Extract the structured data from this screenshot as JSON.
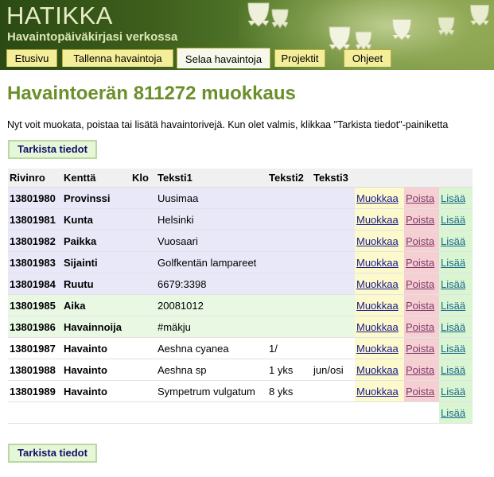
{
  "header": {
    "brand_title": "HATIKKA",
    "brand_subtitle": "Havaintopäiväkirjasi verkossa",
    "tabs": [
      {
        "label": "Etusivu",
        "active": false
      },
      {
        "label": "Tallenna havaintoja",
        "active": false
      },
      {
        "label": "Selaa havaintoja",
        "active": true
      },
      {
        "label": "Projektit",
        "active": false
      },
      {
        "label": "Ohjeet",
        "active": false
      }
    ]
  },
  "main": {
    "title": "Havaintoerän 811272 muokkaus",
    "intro": "Nyt voit muokata, poistaa tai lisätä havaintorivejä. Kun olet valmis, klikkaa \"Tarkista tiedot\"-painiketta",
    "check_button": "Tarkista tiedot",
    "table": {
      "headers": [
        "Rivinro",
        "Kenttä",
        "Klo",
        "Teksti1",
        "Teksti2",
        "Teksti3"
      ],
      "actions": {
        "edit": "Muokkaa",
        "delete": "Poista",
        "add": "Lisää"
      },
      "rows": [
        {
          "rivinro": "13801980",
          "kentta": "Provinssi",
          "klo": "",
          "teksti1": "Uusimaa",
          "teksti2": "",
          "teksti3": "",
          "shade": "blue"
        },
        {
          "rivinro": "13801981",
          "kentta": "Kunta",
          "klo": "",
          "teksti1": "Helsinki",
          "teksti2": "",
          "teksti3": "",
          "shade": "blue"
        },
        {
          "rivinro": "13801982",
          "kentta": "Paikka",
          "klo": "",
          "teksti1": "Vuosaari",
          "teksti2": "",
          "teksti3": "",
          "shade": "blue"
        },
        {
          "rivinro": "13801983",
          "kentta": "Sijainti",
          "klo": "",
          "teksti1": "Golfkentän lampareet",
          "teksti2": "",
          "teksti3": "",
          "shade": "blue"
        },
        {
          "rivinro": "13801984",
          "kentta": "Ruutu",
          "klo": "",
          "teksti1": "6679:3398",
          "teksti2": "",
          "teksti3": "",
          "shade": "blue"
        },
        {
          "rivinro": "13801985",
          "kentta": "Aika",
          "klo": "",
          "teksti1": "20081012",
          "teksti2": "",
          "teksti3": "",
          "shade": "green"
        },
        {
          "rivinro": "13801986",
          "kentta": "Havainnoija",
          "klo": "",
          "teksti1": "#mäkju",
          "teksti2": "",
          "teksti3": "",
          "shade": "green"
        },
        {
          "rivinro": "13801987",
          "kentta": "Havainto",
          "klo": "",
          "teksti1": "Aeshna cyanea",
          "teksti2": "1/",
          "teksti3": "",
          "shade": "plain"
        },
        {
          "rivinro": "13801988",
          "kentta": "Havainto",
          "klo": "",
          "teksti1": "Aeshna sp",
          "teksti2": "1 yks",
          "teksti3": "jun/osi",
          "shade": "plain"
        },
        {
          "rivinro": "13801989",
          "kentta": "Havainto",
          "klo": "",
          "teksti1": "Sympetrum vulgatum",
          "teksti2": "8 yks",
          "teksti3": "",
          "shade": "plain"
        }
      ]
    }
  },
  "colors": {
    "title_green": "#6b8f2a",
    "tab_yellow": "#f4ee9a",
    "row_blue": "#e8e8f8",
    "row_green": "#e8f8e3",
    "edit_bg": "#fcf9cc",
    "delete_bg": "#f6cfd2",
    "add_bg": "#daf5d2",
    "button_bg": "#e6f7d8"
  },
  "icons": {
    "banner_decor": "lily-of-the-valley-flower-icon"
  }
}
